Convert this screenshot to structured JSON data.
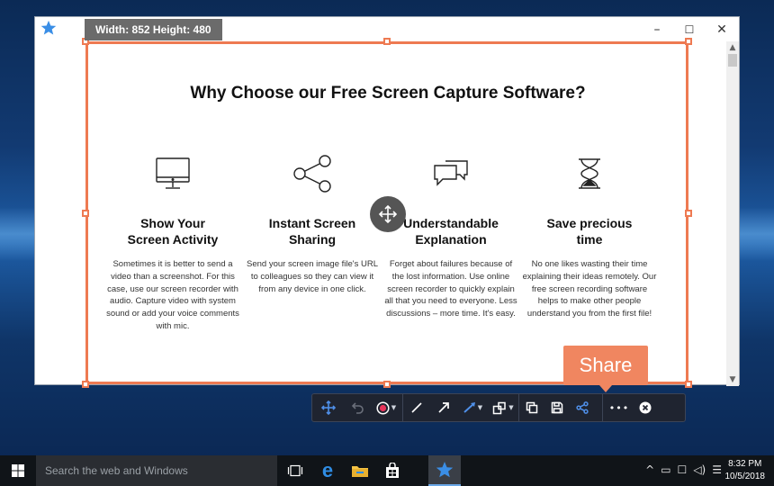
{
  "window": {
    "controls": {
      "minimize": "–",
      "maximize": "☐",
      "close": "✕"
    }
  },
  "page": {
    "title": "Why Choose our Free Screen Capture Software?",
    "features": [
      {
        "icon": "monitor-icon",
        "title_line1": "Show Your",
        "title_line2": "Screen Activity",
        "body": "Sometimes it is better to send a video than a screenshot. For this case, use our screen recorder with audio. Capture video with system sound or add your voice comments with mic."
      },
      {
        "icon": "share-nodes-icon",
        "title_line1": "Instant Screen",
        "title_line2": "Sharing",
        "body": "Send your screen image file's URL to colleagues so they can view it from any device in one click."
      },
      {
        "icon": "chat-bubbles-icon",
        "title_line1": "Understandable",
        "title_line2": "Explanation",
        "body": "Forget about failures because of the lost information. Use online screen recorder to quickly explain all that you need to everyone. Less discussions – more time. It's easy."
      },
      {
        "icon": "hourglass-icon",
        "title_line1": "Save precious",
        "title_line2": "time",
        "body": "No one likes wasting their time explaining their ideas remotely. Our free screen recording software helps to make other people understand you from the first file!"
      }
    ]
  },
  "capture": {
    "dimension_label": "Width: 852 Height: 480",
    "share_tooltip": "Share",
    "accent_color": "#ee7a52"
  },
  "toolbar": {
    "tools": [
      "move-icon",
      "undo-icon",
      "record-icon",
      "line-icon",
      "arrow-icon",
      "marker-icon",
      "shape-icon",
      "copy-icon",
      "save-icon",
      "share-icon",
      "more-icon",
      "close-icon"
    ],
    "more_label": "•••"
  },
  "taskbar": {
    "search_placeholder": "Search the web and Windows",
    "time": "8:32 PM",
    "date": "10/5/2018"
  }
}
